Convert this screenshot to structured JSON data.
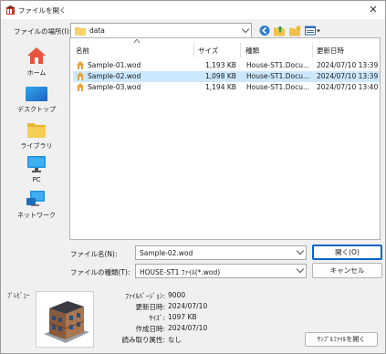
{
  "window": {
    "title": "ファイルを開く",
    "close_glyph": "✕"
  },
  "location": {
    "label": "ファイルの場所(I):",
    "value": "data"
  },
  "places": [
    {
      "label": "ホーム",
      "icon": "home-icon"
    },
    {
      "label": "デスクトップ",
      "icon": "desktop-icon"
    },
    {
      "label": "ライブラリ",
      "icon": "libraries-icon"
    },
    {
      "label": "PC",
      "icon": "pc-icon"
    },
    {
      "label": "ネットワーク",
      "icon": "network-icon"
    }
  ],
  "columns": {
    "name": "名前",
    "size": "サイズ",
    "type": "種類",
    "modified": "更新日時"
  },
  "files": [
    {
      "name": "Sample-01.wod",
      "size": "1,193 KB",
      "type": "House-ST1.Docu...",
      "modified": "2024/07/10 13:39",
      "selected": false
    },
    {
      "name": "Sample-02.wod",
      "size": "1,098 KB",
      "type": "House-ST1.Docu...",
      "modified": "2024/07/10 13:39",
      "selected": true
    },
    {
      "name": "Sample-03.wod",
      "size": "1,194 KB",
      "type": "House-ST1.Docu...",
      "modified": "2024/07/10 13:40",
      "selected": false
    }
  ],
  "filename": {
    "label": "ファイル名(N):",
    "value": "Sample-02.wod"
  },
  "filetype": {
    "label": "ファイルの種類(T):",
    "value": "HOUSE-ST1 ﾌｧｲﾙ(*.wod)"
  },
  "buttons": {
    "open": "開く(O)",
    "cancel": "キャンセル",
    "open_sample": "ｻﾝﾌﾟﾙﾌｧｲﾙを開く"
  },
  "preview": {
    "label": "ﾌﾟﾚﾋﾞｭｰ",
    "fields": [
      {
        "label": "ﾌｧｲﾙﾊﾞｰｼﾞｮﾝ:",
        "value": "9000"
      },
      {
        "label": "更新日時:",
        "value": "2024/07/10"
      },
      {
        "label": "ｻｲｽﾞ:",
        "value": "1097 KB"
      },
      {
        "label": "作成日時:",
        "value": "2024/07/10"
      },
      {
        "label": "読み取り属性:",
        "value": "なし"
      }
    ]
  },
  "colors": {
    "selection": "#cce8ff",
    "accent": "#0067c0",
    "folder": "#f0c24a",
    "file_icon": "#e8a23a"
  }
}
